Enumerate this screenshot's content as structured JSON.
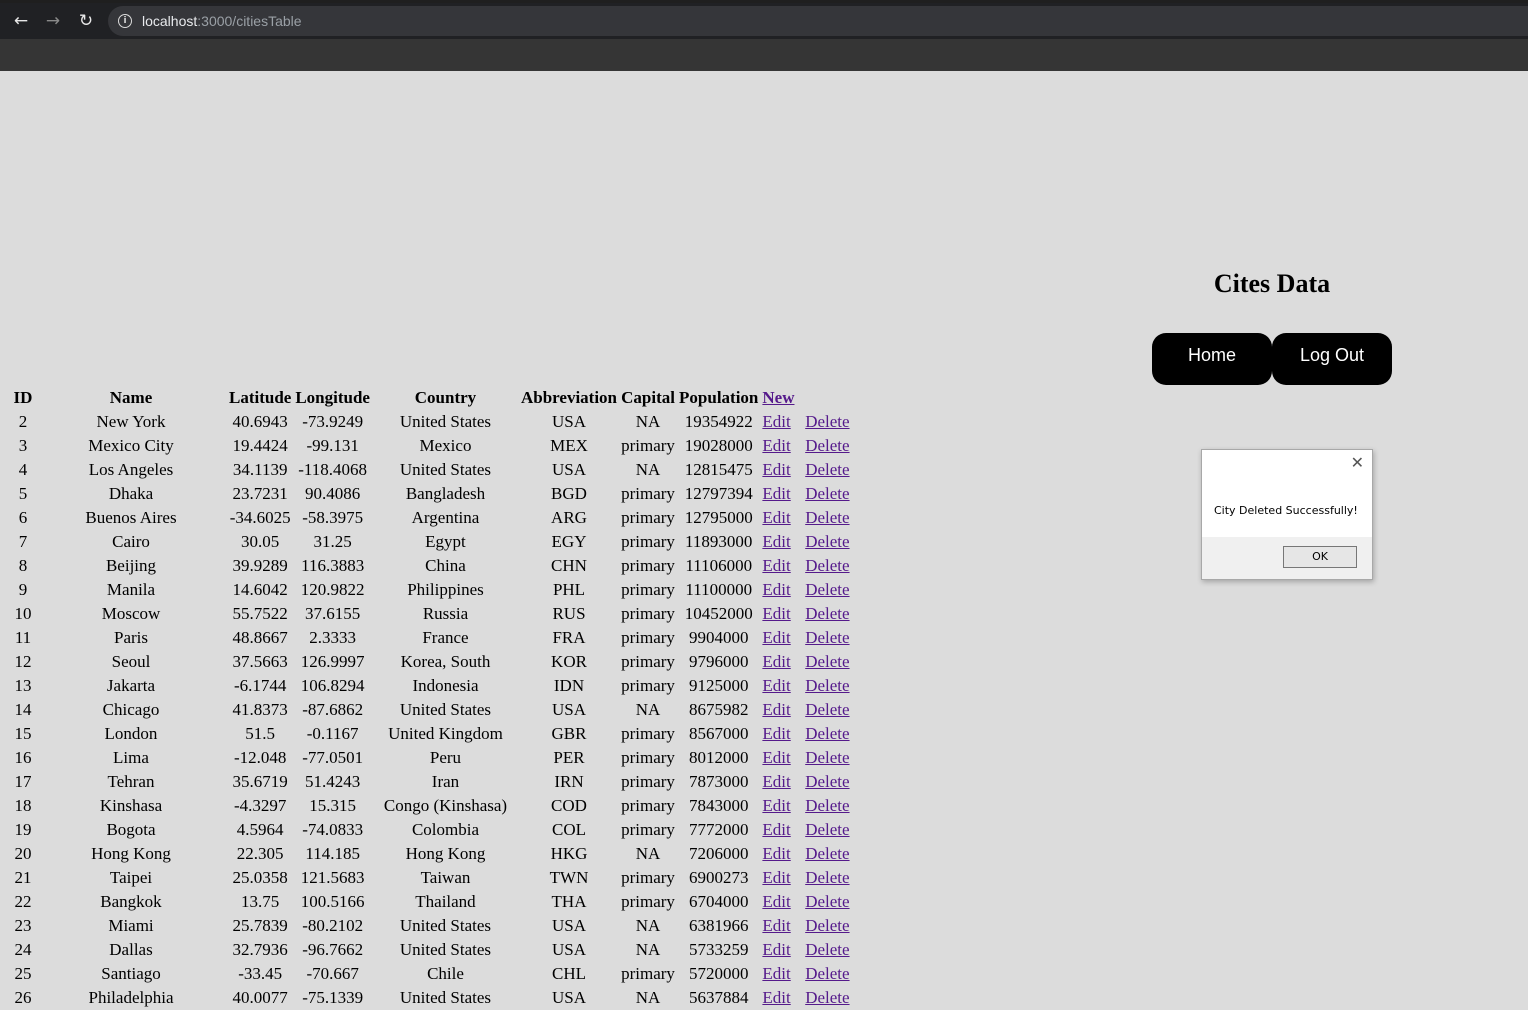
{
  "browser": {
    "url_host": "localhost",
    "url_path": ":3000/citiesTable",
    "back_icon": "←",
    "forward_icon": "→",
    "reload_icon": "↻",
    "info_icon": "i"
  },
  "page": {
    "title": "Cites Data",
    "home_label": "Home",
    "logout_label": "Log Out"
  },
  "table": {
    "headers": {
      "id": "ID",
      "name": "Name",
      "lat": "Latitude",
      "lon": "Longitude",
      "country": "Country",
      "abbr": "Abbreviation",
      "capital": "Capital",
      "population": "Population",
      "new_link": " New"
    },
    "edit_label": " Edit",
    "delete_label": "Delete",
    "rows": [
      {
        "id": "2",
        "name": "New York",
        "lat": "40.6943",
        "lon": "-73.9249",
        "country": "United States",
        "abbr": "USA",
        "capital": "NA",
        "population": "19354922"
      },
      {
        "id": "3",
        "name": "Mexico City",
        "lat": "19.4424",
        "lon": "-99.131",
        "country": "Mexico",
        "abbr": "MEX",
        "capital": "primary",
        "population": "19028000"
      },
      {
        "id": "4",
        "name": "Los Angeles",
        "lat": "34.1139",
        "lon": "-118.4068",
        "country": "United States",
        "abbr": "USA",
        "capital": "NA",
        "population": "12815475"
      },
      {
        "id": "5",
        "name": "Dhaka",
        "lat": "23.7231",
        "lon": "90.4086",
        "country": "Bangladesh",
        "abbr": "BGD",
        "capital": "primary",
        "population": "12797394"
      },
      {
        "id": "6",
        "name": "Buenos Aires",
        "lat": "-34.6025",
        "lon": "-58.3975",
        "country": "Argentina",
        "abbr": "ARG",
        "capital": "primary",
        "population": "12795000"
      },
      {
        "id": "7",
        "name": "Cairo",
        "lat": "30.05",
        "lon": "31.25",
        "country": "Egypt",
        "abbr": "EGY",
        "capital": "primary",
        "population": "11893000"
      },
      {
        "id": "8",
        "name": "Beijing",
        "lat": "39.9289",
        "lon": "116.3883",
        "country": "China",
        "abbr": "CHN",
        "capital": "primary",
        "population": "11106000"
      },
      {
        "id": "9",
        "name": "Manila",
        "lat": "14.6042",
        "lon": "120.9822",
        "country": "Philippines",
        "abbr": "PHL",
        "capital": "primary",
        "population": "11100000"
      },
      {
        "id": "10",
        "name": "Moscow",
        "lat": "55.7522",
        "lon": "37.6155",
        "country": "Russia",
        "abbr": "RUS",
        "capital": "primary",
        "population": "10452000"
      },
      {
        "id": "11",
        "name": "Paris",
        "lat": "48.8667",
        "lon": "2.3333",
        "country": "France",
        "abbr": "FRA",
        "capital": "primary",
        "population": "9904000"
      },
      {
        "id": "12",
        "name": "Seoul",
        "lat": "37.5663",
        "lon": "126.9997",
        "country": "Korea, South",
        "abbr": "KOR",
        "capital": "primary",
        "population": "9796000"
      },
      {
        "id": "13",
        "name": "Jakarta",
        "lat": "-6.1744",
        "lon": "106.8294",
        "country": "Indonesia",
        "abbr": "IDN",
        "capital": "primary",
        "population": "9125000"
      },
      {
        "id": "14",
        "name": "Chicago",
        "lat": "41.8373",
        "lon": "-87.6862",
        "country": "United States",
        "abbr": "USA",
        "capital": "NA",
        "population": "8675982"
      },
      {
        "id": "15",
        "name": "London",
        "lat": "51.5",
        "lon": "-0.1167",
        "country": "United Kingdom",
        "abbr": "GBR",
        "capital": "primary",
        "population": "8567000"
      },
      {
        "id": "16",
        "name": "Lima",
        "lat": "-12.048",
        "lon": "-77.0501",
        "country": "Peru",
        "abbr": "PER",
        "capital": "primary",
        "population": "8012000"
      },
      {
        "id": "17",
        "name": "Tehran",
        "lat": "35.6719",
        "lon": "51.4243",
        "country": "Iran",
        "abbr": "IRN",
        "capital": "primary",
        "population": "7873000"
      },
      {
        "id": "18",
        "name": "Kinshasa",
        "lat": "-4.3297",
        "lon": "15.315",
        "country": "Congo (Kinshasa)",
        "abbr": "COD",
        "capital": "primary",
        "population": "7843000"
      },
      {
        "id": "19",
        "name": "Bogota",
        "lat": "4.5964",
        "lon": "-74.0833",
        "country": "Colombia",
        "abbr": "COL",
        "capital": "primary",
        "population": "7772000"
      },
      {
        "id": "20",
        "name": "Hong Kong",
        "lat": "22.305",
        "lon": "114.185",
        "country": "Hong Kong",
        "abbr": "HKG",
        "capital": "NA",
        "population": "7206000"
      },
      {
        "id": "21",
        "name": "Taipei",
        "lat": "25.0358",
        "lon": "121.5683",
        "country": "Taiwan",
        "abbr": "TWN",
        "capital": "primary",
        "population": "6900273"
      },
      {
        "id": "22",
        "name": "Bangkok",
        "lat": "13.75",
        "lon": "100.5166",
        "country": "Thailand",
        "abbr": "THA",
        "capital": "primary",
        "population": "6704000"
      },
      {
        "id": "23",
        "name": "Miami",
        "lat": "25.7839",
        "lon": "-80.2102",
        "country": "United States",
        "abbr": "USA",
        "capital": "NA",
        "population": "6381966"
      },
      {
        "id": "24",
        "name": "Dallas",
        "lat": "32.7936",
        "lon": "-96.7662",
        "country": "United States",
        "abbr": "USA",
        "capital": "NA",
        "population": "5733259"
      },
      {
        "id": "25",
        "name": "Santiago",
        "lat": "-33.45",
        "lon": "-70.667",
        "country": "Chile",
        "abbr": "CHL",
        "capital": "primary",
        "population": "5720000"
      },
      {
        "id": "26",
        "name": "Philadelphia",
        "lat": "40.0077",
        "lon": "-75.1339",
        "country": "United States",
        "abbr": "USA",
        "capital": "NA",
        "population": "5637884"
      }
    ]
  },
  "dialog": {
    "message": "City Deleted Successfully!",
    "ok_label": "OK",
    "close_icon": "✕"
  },
  "colors": {
    "page_bg": "#dcdcdc",
    "button_bg": "#000000",
    "link": "#551a8b"
  }
}
